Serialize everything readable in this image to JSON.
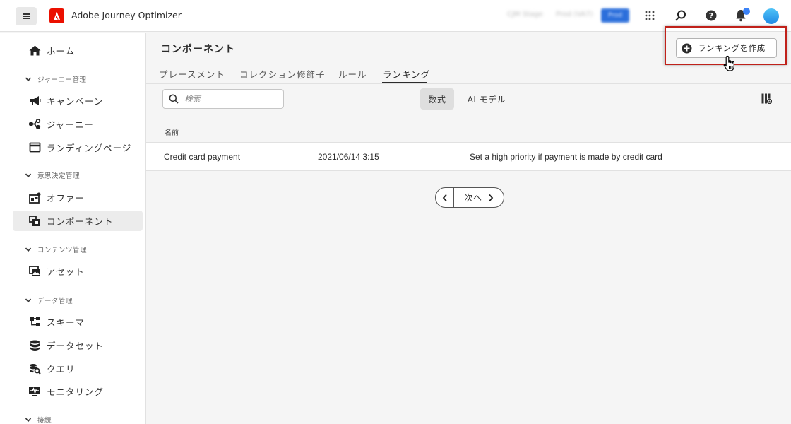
{
  "header": {
    "app_title": "Adobe Journey Optimizer",
    "env_1": "CJM Stage",
    "env_2": "Prod (VA7)",
    "env_badge": "Prod"
  },
  "sidebar": {
    "items": [
      {
        "label": "ホーム",
        "icon": "home-icon"
      },
      {
        "label": "キャンペーン",
        "icon": "megaphone-icon"
      },
      {
        "label": "ジャーニー",
        "icon": "journey-icon"
      },
      {
        "label": "ランディングページ",
        "icon": "landing-page-icon"
      },
      {
        "label": "オファー",
        "icon": "offer-icon"
      },
      {
        "label": "コンポーネント",
        "icon": "components-icon",
        "active": true
      },
      {
        "label": "アセット",
        "icon": "assets-icon"
      },
      {
        "label": "スキーマ",
        "icon": "schema-icon"
      },
      {
        "label": "データセット",
        "icon": "dataset-icon"
      },
      {
        "label": "クエリ",
        "icon": "query-icon"
      },
      {
        "label": "モニタリング",
        "icon": "monitoring-icon"
      }
    ],
    "sections": [
      "ジャーニー管理",
      "意思決定管理",
      "コンテンツ管理",
      "データ管理",
      "接続"
    ]
  },
  "main": {
    "title": "コンポーネント",
    "create_button": "ランキングを作成",
    "tabs": [
      "プレースメント",
      "コレクション修飾子",
      "ルール",
      "ランキング"
    ],
    "active_tab": "ランキング",
    "search_placeholder": "検索",
    "toggle_formula": "数式",
    "toggle_ai": "AI モデル",
    "column_header": "名前",
    "rows": [
      {
        "name": "Credit card payment",
        "date": "2021/06/14 3:15",
        "description": "Set a high priority if payment is made by credit card"
      }
    ],
    "pager_next": "次へ"
  },
  "colors": {
    "accent_red": "#eb1000",
    "highlight": "#c0211a",
    "avatar": "#1e88e5"
  }
}
